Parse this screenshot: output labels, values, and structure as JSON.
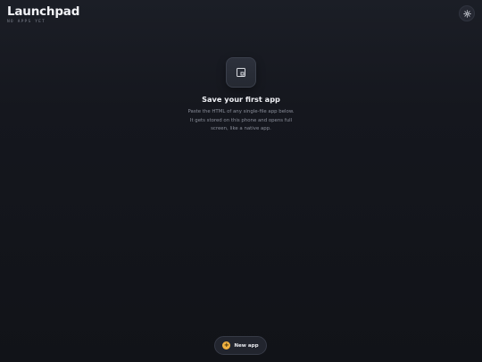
{
  "header": {
    "title": "Launchpad",
    "subtitle": "NO APPS YET"
  },
  "settings": {
    "icon": "gear-icon"
  },
  "empty_state": {
    "icon": "app-window-icon",
    "title": "Save your first app",
    "description": "Paste the HTML of any single-file app below. It gets stored on this phone and opens full screen, like a native app."
  },
  "new_app_button": {
    "label": "New app",
    "icon": "plus-icon",
    "accent_color": "#f0b040"
  }
}
